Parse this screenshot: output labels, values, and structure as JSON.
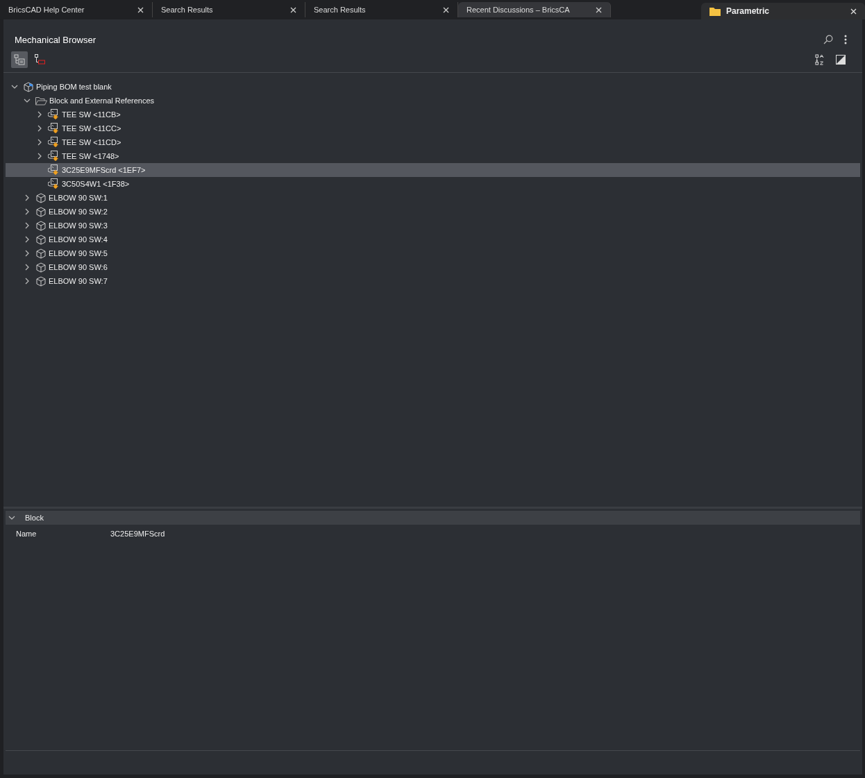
{
  "browser_tabs": [
    {
      "title": "BricsCAD Help Center",
      "selected": false
    },
    {
      "title": "Search Results",
      "selected": false
    },
    {
      "title": "Search Results",
      "selected": false
    },
    {
      "title": "Recent Discussions – BricsCA",
      "selected": true
    }
  ],
  "side_panel": {
    "title": "Parametric"
  },
  "panel": {
    "title": "Mechanical Browser",
    "view_buttons": [
      {
        "kind": "tree",
        "selected": true
      },
      {
        "kind": "links",
        "selected": false
      }
    ],
    "tree": [
      {
        "kind": "assembly",
        "label": "Piping BOM test blank",
        "expanded": true,
        "selected": false,
        "children": [
          {
            "kind": "folder",
            "label": "Block and External References",
            "expanded": true,
            "selected": false,
            "children": [
              {
                "kind": "block",
                "label": "TEE SW <11CB>",
                "expanded": false,
                "selected": false,
                "has_children": true
              },
              {
                "kind": "block",
                "label": "TEE SW <11CC>",
                "expanded": false,
                "selected": false,
                "has_children": true
              },
              {
                "kind": "block",
                "label": "TEE SW <11CD>",
                "expanded": false,
                "selected": false,
                "has_children": true
              },
              {
                "kind": "block",
                "label": "TEE SW <1748>",
                "expanded": false,
                "selected": false,
                "has_children": true
              },
              {
                "kind": "block",
                "label": "3C25E9MFScrd <1EF7>",
                "selected": true,
                "has_children": false
              },
              {
                "kind": "block",
                "label": "3C50S4W1 <1F38>",
                "selected": false,
                "has_children": false
              }
            ]
          },
          {
            "kind": "part",
            "label": "ELBOW 90 SW:1",
            "expanded": false,
            "selected": false,
            "has_children": true
          },
          {
            "kind": "part",
            "label": "ELBOW 90 SW:2",
            "expanded": false,
            "selected": false,
            "has_children": true
          },
          {
            "kind": "part",
            "label": "ELBOW 90 SW:3",
            "expanded": false,
            "selected": false,
            "has_children": true
          },
          {
            "kind": "part",
            "label": "ELBOW 90 SW:4",
            "expanded": false,
            "selected": false,
            "has_children": true
          },
          {
            "kind": "part",
            "label": "ELBOW 90 SW:5",
            "expanded": false,
            "selected": false,
            "has_children": true
          },
          {
            "kind": "part",
            "label": "ELBOW 90 SW:6",
            "expanded": false,
            "selected": false,
            "has_children": true
          },
          {
            "kind": "part",
            "label": "ELBOW 90 SW:7",
            "expanded": false,
            "selected": false,
            "has_children": true
          }
        ]
      }
    ],
    "properties": {
      "section": "Block",
      "expanded": true,
      "rows": [
        {
          "name": "Name",
          "value": "3C25E9MFScrd"
        }
      ]
    }
  }
}
